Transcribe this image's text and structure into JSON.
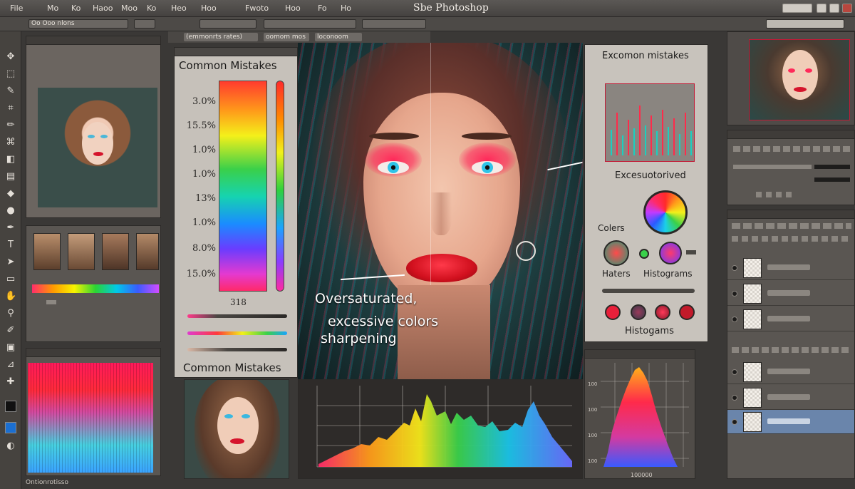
{
  "app": {
    "title": "Sbe Photoshop"
  },
  "menu": {
    "items": [
      "File",
      "Mo",
      "Ko",
      "Haoo",
      "Moo",
      "Ko",
      "Heo",
      "Hoo",
      "Fwoto",
      "Hoo",
      "Fo",
      "Ho"
    ]
  },
  "options": {
    "doc_tab": "Oo Ooo nlons",
    "tabs": [
      "(emmonrts rates)",
      "oomom mos",
      "loconoom"
    ]
  },
  "left_panel": {
    "footer_label": "Ontionrotisso"
  },
  "mistakes_panel": {
    "title": "Common Mistakes",
    "percentages": [
      "3.0%",
      "15.5%",
      "1.0%",
      "1.0%",
      "13%",
      "1.0%",
      "8.0%",
      "15.0%"
    ],
    "value": "318",
    "footer_title": "Common Mistakes"
  },
  "canvas": {
    "caption_line1": "Oversaturated,",
    "caption_line2": "excessive colors",
    "caption_line3": "sharpening"
  },
  "right_mistakes_panel": {
    "title": "Excomon mistakes",
    "subtitle": "Excesuotorived",
    "colors_label": "Colers",
    "haters_label": "Haters",
    "histograms_label": "Histograms",
    "histograms_bottom": "Histogams"
  },
  "histogram_panel": {
    "ylabels": [
      "100",
      "100",
      "100",
      "100"
    ],
    "bottom_label": "100000"
  },
  "colors": {
    "accent_red": "#e8203a",
    "panel_gray": "#5a5652",
    "bg_dark": "#3a3836",
    "teal": "#2f6a6a"
  }
}
